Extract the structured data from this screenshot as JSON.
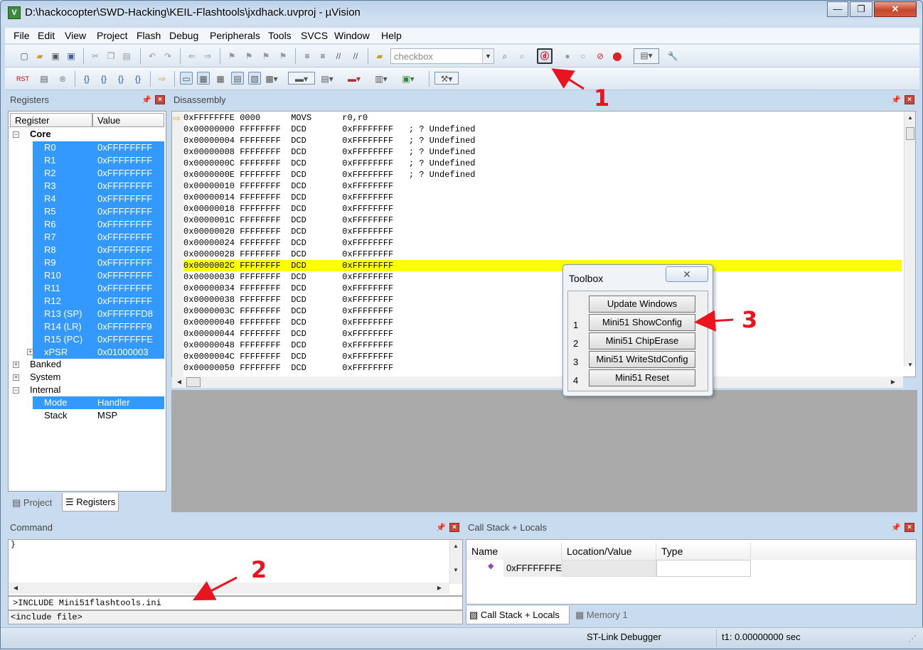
{
  "window": {
    "title": "D:\\hackocopter\\SWD-Hacking\\KEIL-Flashtools\\jxdhack.uvproj - µVision",
    "minimize": "—",
    "restore": "❐",
    "close": "✕"
  },
  "menu": [
    "File",
    "Edit",
    "View",
    "Project",
    "Flash",
    "Debug",
    "Peripherals",
    "Tools",
    "SVCS",
    "Window",
    "Help"
  ],
  "toolbar": {
    "combo_value": "checkbox"
  },
  "registers": {
    "title": "Registers",
    "col_register": "Register",
    "col_value": "Value",
    "core": "Core",
    "rows": [
      {
        "name": "R0",
        "value": "0xFFFFFFFF"
      },
      {
        "name": "R1",
        "value": "0xFFFFFFFF"
      },
      {
        "name": "R2",
        "value": "0xFFFFFFFF"
      },
      {
        "name": "R3",
        "value": "0xFFFFFFFF"
      },
      {
        "name": "R4",
        "value": "0xFFFFFFFF"
      },
      {
        "name": "R5",
        "value": "0xFFFFFFFF"
      },
      {
        "name": "R6",
        "value": "0xFFFFFFFF"
      },
      {
        "name": "R7",
        "value": "0xFFFFFFFF"
      },
      {
        "name": "R8",
        "value": "0xFFFFFFFF"
      },
      {
        "name": "R9",
        "value": "0xFFFFFFFF"
      },
      {
        "name": "R10",
        "value": "0xFFFFFFFF"
      },
      {
        "name": "R11",
        "value": "0xFFFFFFFF"
      },
      {
        "name": "R12",
        "value": "0xFFFFFFFF"
      },
      {
        "name": "R13 (SP)",
        "value": "0xFFFFFFD8"
      },
      {
        "name": "R14 (LR)",
        "value": "0xFFFFFFF9"
      },
      {
        "name": "R15 (PC)",
        "value": "0xFFFFFFFE"
      },
      {
        "name": "xPSR",
        "value": "0x01000003"
      }
    ],
    "banked": "Banked",
    "system": "System",
    "internal": "Internal",
    "mode_name": "Mode",
    "mode_value": "Handler",
    "stack_name": "Stack",
    "stack_value": "MSP",
    "tab_project": "Project",
    "tab_registers": "Registers"
  },
  "disassembly": {
    "title": "Disassembly",
    "lines": [
      "0xFFFFFFFE 0000      MOVS      r0,r0",
      "0x00000000 FFFFFFFF  DCD       0xFFFFFFFF   ; ? Undefined",
      "0x00000004 FFFFFFFF  DCD       0xFFFFFFFF   ; ? Undefined",
      "0x00000008 FFFFFFFF  DCD       0xFFFFFFFF   ; ? Undefined",
      "0x0000000C FFFFFFFF  DCD       0xFFFFFFFF   ; ? Undefined",
      "0x0000000E FFFFFFFF  DCD       0xFFFFFFFF   ; ? Undefined",
      "0x00000010 FFFFFFFF  DCD       0xFFFFFFFF",
      "0x00000014 FFFFFFFF  DCD       0xFFFFFFFF",
      "0x00000018 FFFFFFFF  DCD       0xFFFFFFFF",
      "0x0000001C FFFFFFFF  DCD       0xFFFFFFFF",
      "0x00000020 FFFFFFFF  DCD       0xFFFFFFFF",
      "0x00000024 FFFFFFFF  DCD       0xFFFFFFFF",
      "0x00000028 FFFFFFFF  DCD       0xFFFFFFFF",
      "0x0000002C FFFFFFFF  DCD       0xFFFFFFFF",
      "0x00000030 FFFFFFFF  DCD       0xFFFFFFFF",
      "0x00000034 FFFFFFFF  DCD       0xFFFFFFFF",
      "0x00000038 FFFFFFFF  DCD       0xFFFFFFFF",
      "0x0000003C FFFFFFFF  DCD       0xFFFFFFFF",
      "0x00000040 FFFFFFFF  DCD       0xFFFFFFFF",
      "0x00000044 FFFFFFFF  DCD       0xFFFFFFFF",
      "0x00000048 FFFFFFFF  DCD       0xFFFFFFFF",
      "0x0000004C FFFFFFFF  DCD       0xFFFFFFFF",
      "0x00000050 FFFFFFFF  DCD       0xFFFFFFFF"
    ]
  },
  "toolbox": {
    "title": "Toolbox",
    "buttons": [
      "Update Windows",
      "Mini51 ShowConfig",
      "Mini51 ChipErase",
      "Mini51 WriteStdConfig",
      "Mini51 Reset"
    ],
    "numbers": [
      "1",
      "2",
      "3",
      "4"
    ]
  },
  "command": {
    "title": "Command",
    "output": "}",
    "input": ">INCLUDE Mini51flashtools.ini",
    "hint": "<include file>"
  },
  "callstack": {
    "title": "Call Stack + Locals",
    "col_name": "Name",
    "col_location": "Location/Value",
    "col_type": "Type",
    "row_value": "0xFFFFFFFE",
    "tab_callstack": "Call Stack + Locals",
    "tab_memory": "Memory 1"
  },
  "status": {
    "debugger": "ST-Link Debugger",
    "time": "t1: 0.00000000 sec"
  },
  "annotations": [
    "1",
    "2",
    "3"
  ],
  "colors": {
    "selection": "#3399ff",
    "highlight": "#ffff00",
    "annotation": "#e8141e"
  }
}
